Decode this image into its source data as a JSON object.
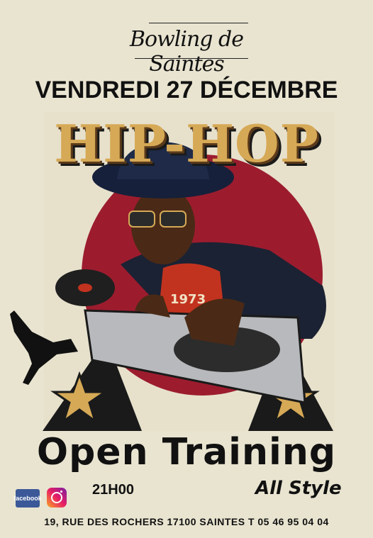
{
  "logo": {
    "text": "Bowling de Saintes"
  },
  "event": {
    "date": "VENDREDI 27 DÉCEMBRE",
    "headline": "HIP-HOP",
    "title": "Open Training",
    "time": "21H00",
    "style": "All Style",
    "shirt_number": "1973"
  },
  "social": {
    "facebook_label": "facebook"
  },
  "footer": {
    "address": "19, RUE DES ROCHERS 17100 SAINTES T 05 46 95 04 04"
  },
  "colors": {
    "background": "#e9e4d0",
    "headline": "#d6a956",
    "circle": "#9c1c2e",
    "accent": "#c2331f"
  }
}
